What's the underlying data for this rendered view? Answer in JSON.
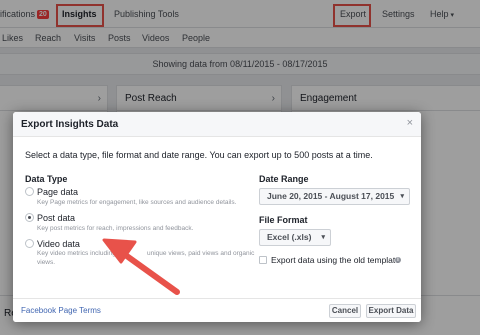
{
  "topnav": {
    "notifications_label": "ifications",
    "notifications_badge": "20",
    "insights": "Insights",
    "publishing_tools": "Publishing Tools",
    "export": "Export",
    "settings": "Settings",
    "help": "Help"
  },
  "subnav": [
    "Likes",
    "Reach",
    "Visits",
    "Posts",
    "Videos",
    "People"
  ],
  "showing_data": "Showing data from 08/11/2015 - 08/17/2015",
  "cards": {
    "post_reach": "Post Reach",
    "engagement": "Engagement",
    "bottom_left": "Re"
  },
  "dialog": {
    "title": "Export Insights Data",
    "intro": "Select a data type, file format and date range. You can export up to 500 posts at a time.",
    "data_type": {
      "title": "Data Type",
      "options": [
        {
          "label": "Page data",
          "desc": "Key Page metrics for engagement, like sources and audience details.",
          "checked": false
        },
        {
          "label": "Post data",
          "desc": "Key post metrics for reach, impressions and feedback.",
          "checked": true
        },
        {
          "label": "Video data",
          "desc1": "Key video metrics including",
          "desc1b": "unique views, paid views and organic",
          "desc2": "views.",
          "checked": false
        }
      ]
    },
    "date_range": {
      "title": "Date Range",
      "value": "June 20, 2015 - August 17, 2015"
    },
    "file_format": {
      "title": "File Format",
      "value": "Excel (.xls)"
    },
    "old_template_label": "Export data using the old template",
    "footer": {
      "terms_link": "Facebook Page Terms",
      "cancel": "Cancel",
      "export": "Export Data"
    }
  },
  "colors": {
    "highlight_box": "#e8524a",
    "arrow": "#e8524a",
    "link": "#4267b2"
  }
}
